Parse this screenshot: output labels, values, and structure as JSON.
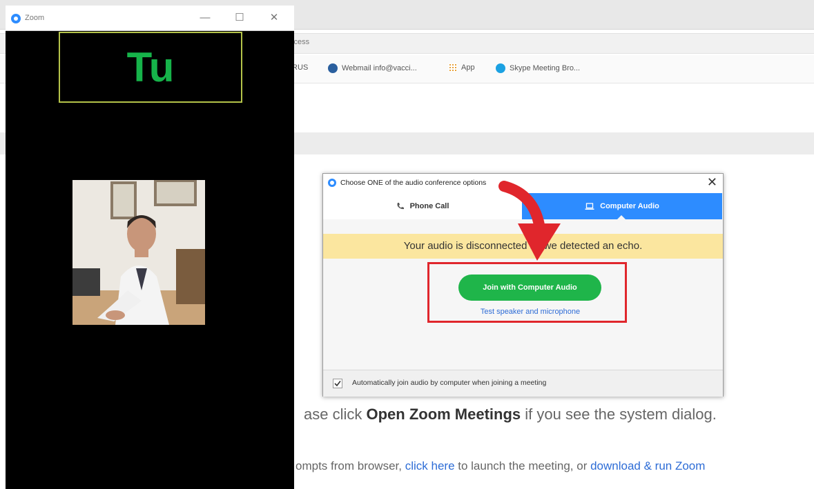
{
  "browser": {
    "address_text": "ccess",
    "bookmarks": [
      {
        "label": "IRUS",
        "icon": "bookmark-icon"
      },
      {
        "label": "Webmail info@vacci...",
        "icon": "webmail-icon"
      },
      {
        "label": "App",
        "icon": "apps-grid-icon"
      },
      {
        "label": "Skype Meeting Bro...",
        "icon": "skype-icon"
      }
    ],
    "instruction_1_pre": "ase click ",
    "instruction_1_bold": "Open Zoom Meetings",
    "instruction_1_post": " if you see the system dialog.",
    "instruction_2_pre": "ompts from browser, ",
    "instruction_2_link1": "click here",
    "instruction_2_mid": " to launch the meeting, or ",
    "instruction_2_link2": "download & run Zoom"
  },
  "zoom_window": {
    "title": "Zoom",
    "minimize": "—",
    "maximize": "☐",
    "close": "✕",
    "active_speaker_label": "Tu"
  },
  "audio_dialog": {
    "title": "Choose ONE of the audio conference options",
    "close": "✕",
    "tabs": [
      {
        "label": "Phone Call",
        "icon": "phone-icon",
        "selected": false
      },
      {
        "label": "Computer Audio",
        "icon": "laptop-icon",
        "selected": true
      }
    ],
    "echo_banner": "Your audio is disconnected as we detected an echo.",
    "join_button": "Join with Computer Audio",
    "test_link": "Test speaker and microphone",
    "auto_join_label": "Automatically join audio by computer when joining a meeting",
    "auto_join_checked": true
  },
  "colors": {
    "zoom_blue": "#2d8cff",
    "join_green": "#1fb54a",
    "echo_yellow": "#fbe69f",
    "highlight_red": "#e0262c"
  }
}
